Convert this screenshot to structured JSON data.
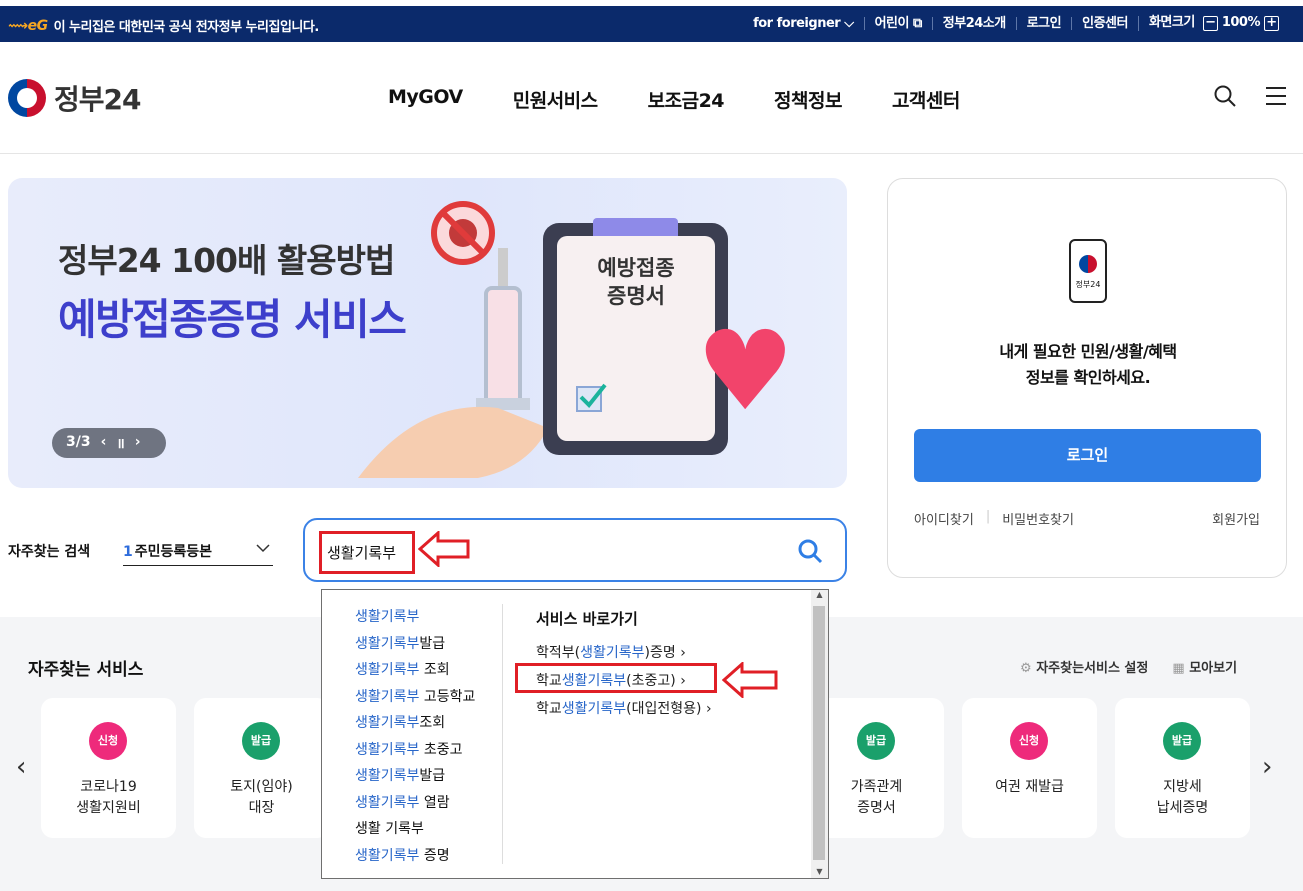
{
  "topbar": {
    "notice": "이 누리집은 대한민국 공식 전자정부 누리집입니다.",
    "items": [
      "for foreigner",
      "어린이",
      "정부24소개",
      "로그인",
      "인증센터",
      "화면크기"
    ],
    "zoom": "100%"
  },
  "header": {
    "logo": "정부24",
    "nav": [
      "MyGOV",
      "민원서비스",
      "보조금24",
      "정책정보",
      "고객센터"
    ]
  },
  "banner": {
    "title1": "정부24 100배 활용방법",
    "title2": "예방접종증명 서비스",
    "paper": "예방접종\n증명서",
    "pager": "3/3"
  },
  "login_panel": {
    "phone_label": "정부24",
    "message_line1": "내게 필요한 민원/생활/혜택",
    "message_line2": "정보를 확인하세요.",
    "login_button": "로그인",
    "find_id": "아이디찾기",
    "find_pw": "비밀번호찾기",
    "join": "회원가입"
  },
  "search": {
    "fav_label": "자주찾는 검색",
    "fav_number": "1",
    "fav_value": "주민등록등본",
    "value": "생활기록부"
  },
  "autocomplete": {
    "items": [
      {
        "hi": "생활기록부",
        "rest": ""
      },
      {
        "hi": "생활기록부",
        "rest": "발급"
      },
      {
        "hi": "생활기록부",
        "rest": " 조회"
      },
      {
        "hi": "생활기록부",
        "rest": " 고등학교"
      },
      {
        "hi": "생활기록부",
        "rest": "조회"
      },
      {
        "hi": "생활기록부",
        "rest": " 초중고"
      },
      {
        "hi": "생활기록부",
        "rest": "발급"
      },
      {
        "hi": "생활기록부",
        "rest": " 열람"
      },
      {
        "hi": "",
        "rest": "생활 기록부"
      },
      {
        "hi": "생활기록부",
        "rest": " 증명"
      }
    ],
    "quick_title": "서비스 바로가기",
    "quick": [
      {
        "pre": "학적부(",
        "hi": "생활기록부",
        "post": ")증명"
      },
      {
        "pre": "학교",
        "hi": "생활기록부",
        "post": "(초중고)"
      },
      {
        "pre": "학교",
        "hi": "생활기록부",
        "post": "(대입전형용)"
      }
    ]
  },
  "services": {
    "title": "자주찾는 서비스",
    "settings": "자주찾는서비스 설정",
    "view_all": "모아보기",
    "cards": [
      {
        "badge": "신청",
        "color": "pink",
        "label": "코로나19\n생활지원비"
      },
      {
        "badge": "발급",
        "color": "green",
        "label": "토지(임야)\n대장"
      },
      {
        "badge": "발급",
        "color": "green",
        "label": "가족관계\n증명서"
      },
      {
        "badge": "신청",
        "color": "pink",
        "label": "여권 재발급"
      },
      {
        "badge": "발급",
        "color": "green",
        "label": "지방세\n납세증명"
      }
    ]
  }
}
